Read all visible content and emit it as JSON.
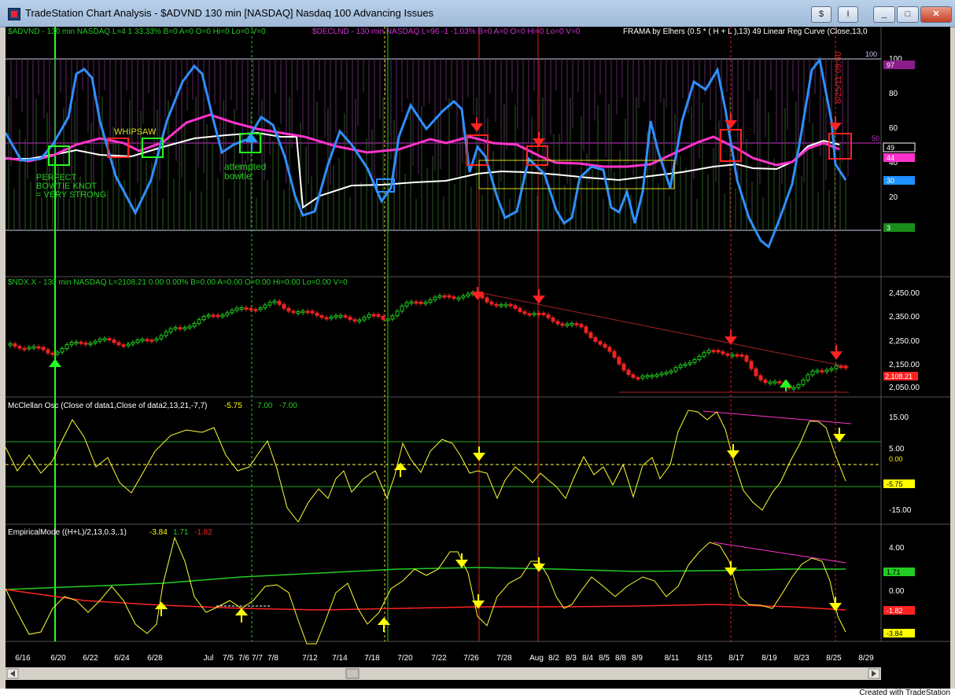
{
  "window": {
    "title": "TradeStation Chart Analysis - $ADVND 130 min [NASDAQ] Nasdaq 100 Advancing Issues",
    "buttons": [
      "$",
      "I",
      "_",
      "□",
      "✕"
    ]
  },
  "footer": {
    "text": "Created with TradeStation"
  },
  "pane1": {
    "header_adv": "$ADVND - 130 min  NASDAQ  L=4  1  33.33%  B=0  A=0  O=0  Hi=0  Lo=0  V=0",
    "header_dec": "$DECLND - 130 min  NASDAQ  L=96  -1  -1.03%  B=0  A=0  O=0  Hi=0  Lo=0  V=0",
    "header_ind": "FRAMA by Elhers (0.5 * ( H + L ),13)  49  Linear Reg Curve (Close,13,0",
    "axis_labels": [
      "100",
      "80",
      "60",
      "40",
      "20",
      "0"
    ],
    "level_100": "100",
    "level_50": "50",
    "badges": [
      {
        "text": "97",
        "color": "#8a1d8a"
      },
      {
        "text": "49",
        "color": "#ffffff"
      },
      {
        "text": "44",
        "color": "#ff33cc"
      },
      {
        "text": "30",
        "color": "#1e90ff"
      },
      {
        "text": "3",
        "color": "#1a8c1a"
      }
    ],
    "annotations": {
      "whipsaw": "WHIPSAW",
      "perfect": "PERFECT",
      "bowtie_knot": "BOWTIE KNOT",
      "very_strong": "= VERY STRONG",
      "attempted": "attempted",
      "bowtie": "bowtie",
      "vertical_date": "8/25/11 09:40"
    },
    "colors": {
      "fast": "#2f8fff",
      "slow": "#ff33cc",
      "frama": "#ffffff",
      "box": "#ff2222",
      "green_box": "#22cc22"
    }
  },
  "pane2": {
    "header": "$NDX.X - 130 min  NASDAQ  L=2108.21  0.00  0.00%  B=0.00  A=0.00  O=0.00  Hi=0.00  Lo=0.00  V=0",
    "axis_labels": [
      "2,450.00",
      "2,350.00",
      "2,250.00",
      "2,150.00",
      "2,050.00"
    ],
    "last_badge": "2,108.21"
  },
  "pane3": {
    "header": "McClellan Osc (Close of data1,Close of data2,13,21,-7,7)",
    "header_values": [
      "-5.75",
      "7.00",
      "-7.00"
    ],
    "axis_labels": [
      "15.00",
      "5.00",
      "-15.00"
    ],
    "zero_label": "0.00",
    "last_badge": "-5.75"
  },
  "pane4": {
    "header": "EmpiricalMode ((H+L)/2,13,0.3,.1)",
    "header_values": [
      "-3.84",
      "1.71",
      "-1.82"
    ],
    "axis_labels": [
      "4.00",
      "0.00"
    ],
    "badges": [
      {
        "text": "1.71",
        "color": "#22cc22"
      },
      {
        "text": "-1.82",
        "color": "#ff2222"
      },
      {
        "text": "-3.84",
        "color": "#ffff00"
      }
    ]
  },
  "x_axis": {
    "labels": [
      "6/16",
      "6/20",
      "6/22",
      "6/24",
      "6/28",
      "Jul",
      "7/5",
      "7/6",
      "7/7",
      "7/8",
      "7/12",
      "7/14",
      "7/18",
      "7/20",
      "7/22",
      "7/26",
      "7/28",
      "Aug",
      "8/2",
      "8/3",
      "8/4",
      "8/5",
      "8/8",
      "8/9",
      "8/11",
      "8/15",
      "8/17",
      "8/19",
      "8/23",
      "8/25",
      "8/29"
    ]
  }
}
